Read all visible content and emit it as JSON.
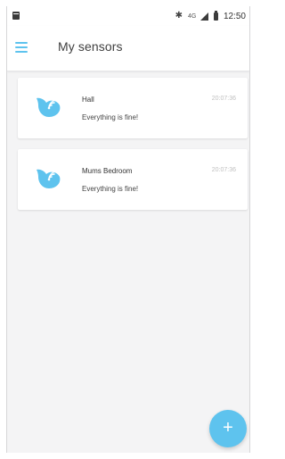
{
  "status_bar": {
    "bluetooth_icon": "bluetooth-icon",
    "network_label": "4G",
    "time": "12:50"
  },
  "app_bar": {
    "title": "My sensors",
    "menu_icon": "hamburger-menu-icon"
  },
  "colors": {
    "accent": "#5ec3ee",
    "background": "#f4f4f5",
    "card": "#ffffff"
  },
  "sensors": [
    {
      "name": "Hall",
      "status": "Everything is fine!",
      "time": "20:07:36",
      "icon": "sensor-wifi-icon"
    },
    {
      "name": "Mums Bedroom",
      "status": "Everything is fine!",
      "time": "20:07:36",
      "icon": "sensor-wifi-icon"
    }
  ],
  "fab": {
    "label": "+",
    "icon": "add-icon"
  }
}
